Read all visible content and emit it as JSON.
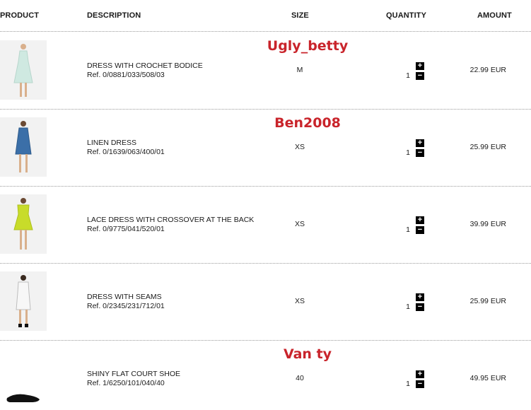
{
  "header": {
    "product": "PRODUCT",
    "description": "DESCRIPTION",
    "size": "SIZE",
    "quantity": "QUANTITY",
    "amount": "AMOUNT"
  },
  "controls": {
    "plus": "+",
    "minus": "−"
  },
  "items": [
    {
      "name": "DRESS WITH CROCHET BODICE",
      "ref": "Ref. 0/0881/033/508/03",
      "size": "M",
      "qty": "1",
      "amount": "22.99 EUR",
      "user": "Ugly_betty",
      "color": "#cfe9e1"
    },
    {
      "name": "LINEN DRESS",
      "ref": "Ref. 0/1639/063/400/01",
      "size": "XS",
      "qty": "1",
      "amount": "25.99 EUR",
      "user": "Ben2008",
      "color": "#3b6fa8"
    },
    {
      "name": "LACE DRESS WITH CROSSOVER AT THE BACK",
      "ref": "Ref. 0/9775/041/520/01",
      "size": "XS",
      "qty": "1",
      "amount": "39.99 EUR",
      "user": "",
      "color": "#c8dc2a"
    },
    {
      "name": "DRESS WITH SEAMS",
      "ref": "Ref. 0/2345/231/712/01",
      "size": "XS",
      "qty": "1",
      "amount": "25.99 EUR",
      "user": "",
      "color": "#f3f3f3"
    },
    {
      "name": "SHINY FLAT COURT SHOE",
      "ref": "Ref. 1/6250/101/040/40",
      "size": "40",
      "qty": "1",
      "amount": "49.95 EUR",
      "user": "Van ty",
      "color": "#111111"
    }
  ]
}
